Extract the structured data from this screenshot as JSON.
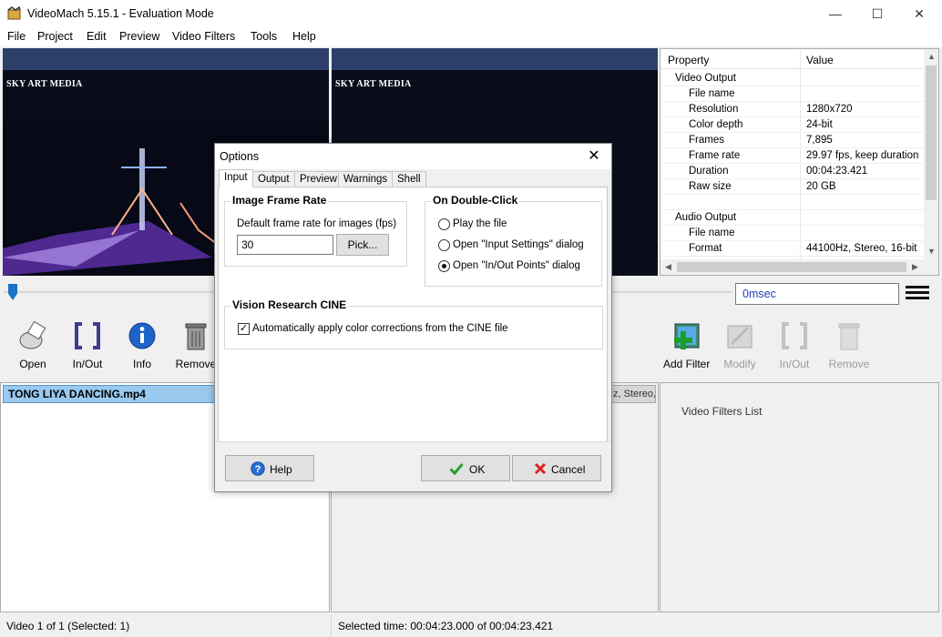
{
  "window": {
    "title": "VideoMach 5.15.1 - Evaluation Mode",
    "minimize": "—",
    "maximize": "☐",
    "close": "✕"
  },
  "menu": [
    "File",
    "Project",
    "Edit",
    "Preview",
    "Video Filters",
    "Tools",
    "Help"
  ],
  "preview": {
    "caption_left": "SKY ART MEDIA",
    "caption_right": "SKY ART MEDIA"
  },
  "properties": {
    "col_property": "Property",
    "col_value": "Value",
    "rows": [
      {
        "key": "Video Output",
        "value": "",
        "group": true
      },
      {
        "key": "File name",
        "value": ""
      },
      {
        "key": "Resolution",
        "value": "1280x720"
      },
      {
        "key": "Color depth",
        "value": "24-bit"
      },
      {
        "key": "Frames",
        "value": "7,895"
      },
      {
        "key": "Frame rate",
        "value": "29.97 fps, keep duration"
      },
      {
        "key": "Duration",
        "value": "00:04:23.421"
      },
      {
        "key": "Raw size",
        "value": "20 GB"
      },
      {
        "key": "",
        "value": ""
      },
      {
        "key": "Audio Output",
        "value": "",
        "group": true
      },
      {
        "key": "File name",
        "value": ""
      },
      {
        "key": "Format",
        "value": "44100Hz, Stereo, 16-bit"
      }
    ]
  },
  "timebox": "0msec",
  "left_toolbar": [
    "Open",
    "In/Out",
    "Info",
    "Remove"
  ],
  "right_toolbar": [
    "Add Filter",
    "Modify",
    "In/Out",
    "Remove"
  ],
  "file_list": {
    "item": "TONG LIYA DANCING.mp4"
  },
  "mid_header": "z, Stereo,",
  "filters_placeholder": "Video Filters List",
  "status": {
    "videos": "Video 1 of 1  (Selected: 1)",
    "selected_time": "Selected time:  00:04:23.000  of  00:04:23.421"
  },
  "dialog": {
    "title": "Options",
    "tabs": [
      "Input",
      "Output",
      "Preview",
      "Warnings",
      "Shell"
    ],
    "frame_rate_group": "Image Frame Rate",
    "frame_rate_label": "Default frame rate for images (fps)",
    "frame_rate_value": "30",
    "pick_button": "Pick...",
    "double_click_group": "On Double-Click",
    "double_click_options": [
      "Play the file",
      "Open \"Input Settings\" dialog",
      "Open \"In/Out Points\" dialog"
    ],
    "double_click_selected": 2,
    "cine_group": "Vision Research CINE",
    "cine_checkbox": "Automatically apply color corrections from the CINE file",
    "cine_checked": true,
    "help": "Help",
    "ok": "OK",
    "cancel": "Cancel"
  }
}
